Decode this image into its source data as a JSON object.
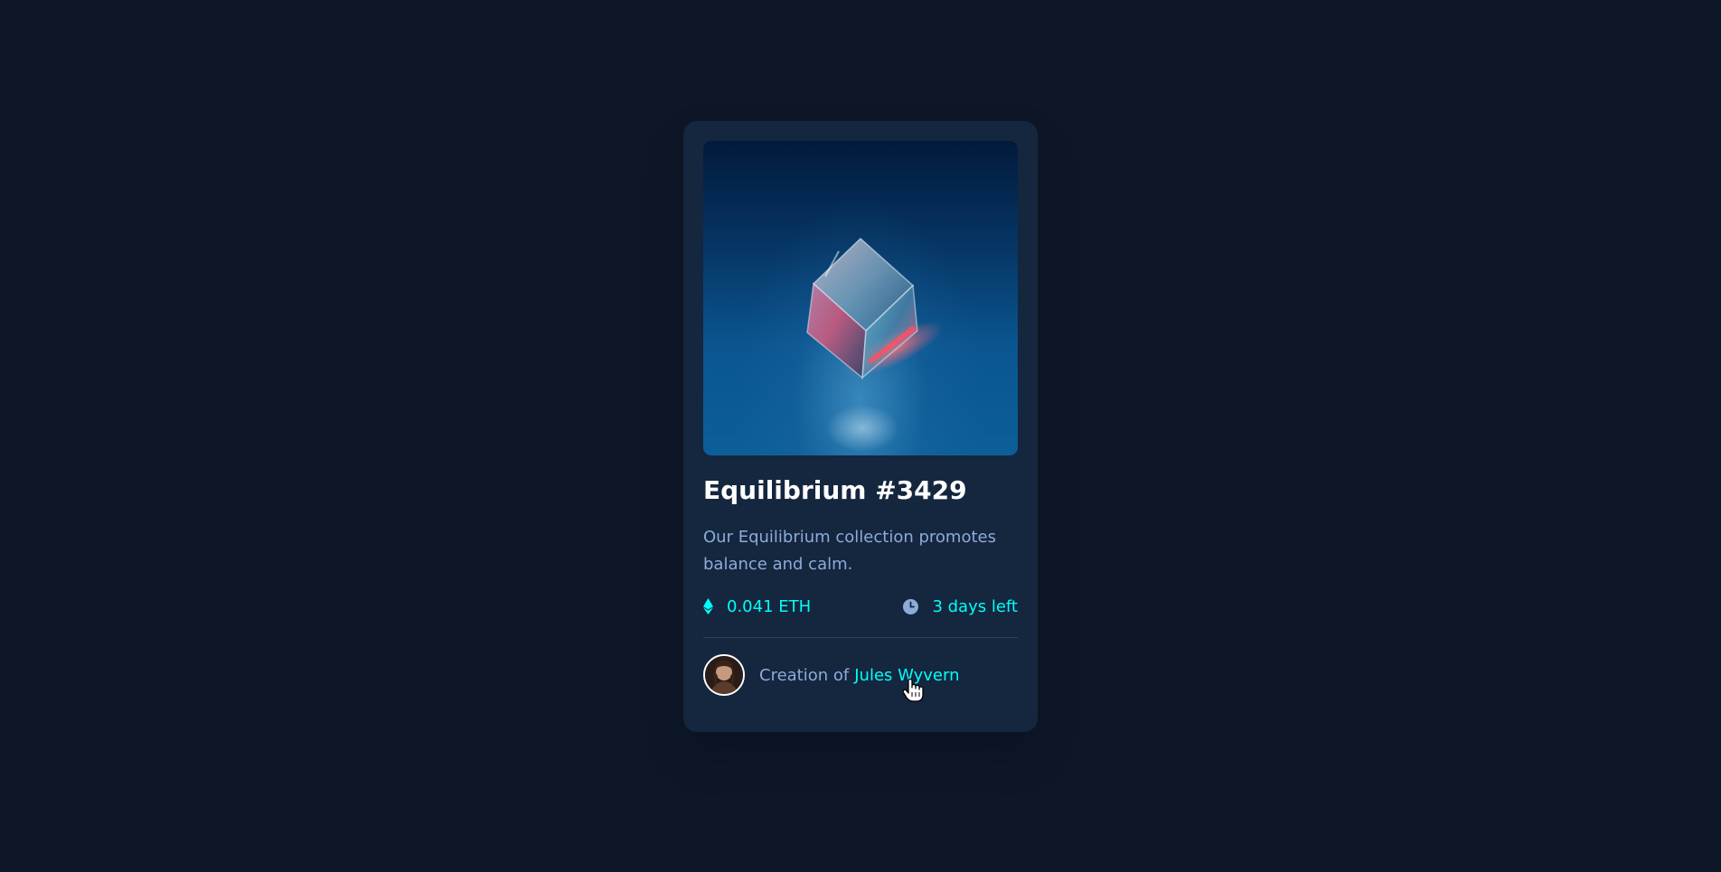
{
  "card": {
    "title": "Equilibrium #3429",
    "description": "Our Equilibrium collection promotes balance and calm.",
    "price": "0.041 ETH",
    "time_left": "3 days left",
    "creator_prefix": "Creation of",
    "creator_name": "Jules Wyvern"
  },
  "icons": {
    "price": "ethereum-icon",
    "time": "clock-icon",
    "avatar": "avatar-image",
    "cursor": "hand-pointer-icon"
  },
  "colors": {
    "background": "#0d1727",
    "card": "#15263f",
    "accent": "#00fff8",
    "soft_blue": "#8bacd9",
    "white": "#ffffff"
  }
}
